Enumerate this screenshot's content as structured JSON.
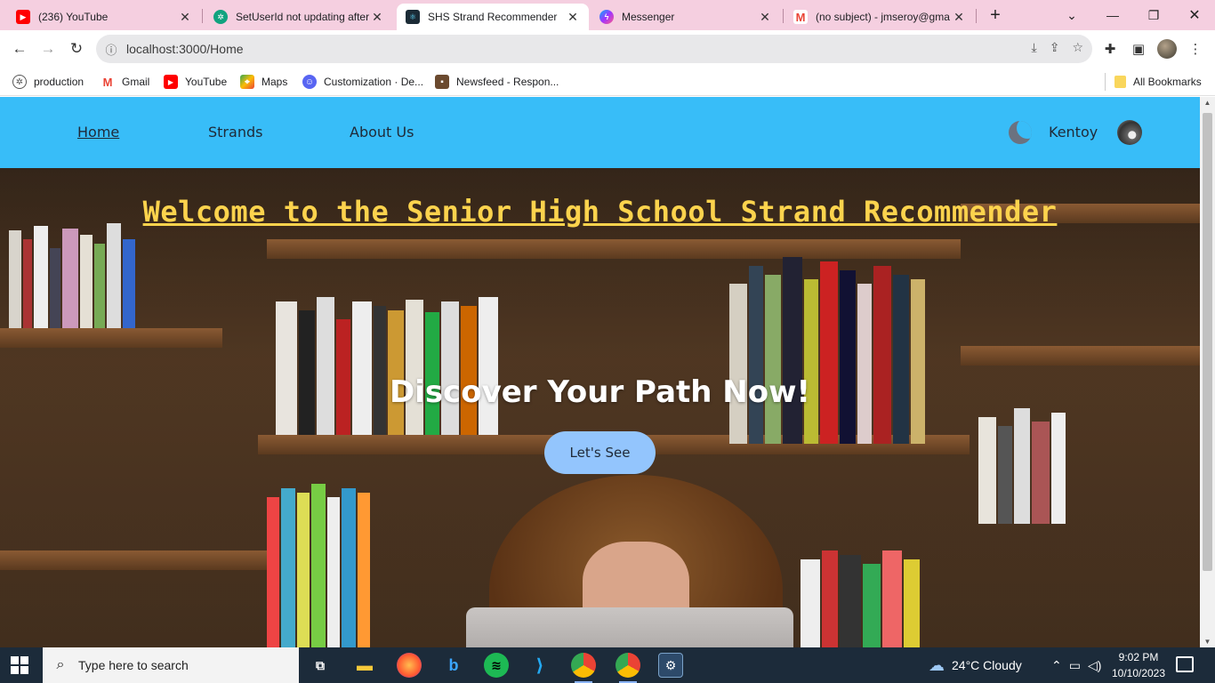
{
  "browser": {
    "tabs": [
      {
        "title": "(236) YouTube",
        "favicon": "youtube-icon",
        "color": "#ff0000"
      },
      {
        "title": "SetUserId not updating after",
        "favicon": "chatgpt-icon",
        "color": "#10a37f"
      },
      {
        "title": "SHS Strand Recommender",
        "favicon": "react-icon",
        "color": "#1b2b36",
        "active": true
      },
      {
        "title": "Messenger",
        "favicon": "messenger-icon",
        "color": "#a033ff"
      },
      {
        "title": "(no subject) - jmseroy@gma",
        "favicon": "gmail-icon",
        "color": "#ea4335"
      }
    ],
    "address": "localhost:3000/Home",
    "bookmarks": [
      {
        "label": "production",
        "icon": "chatgpt-icon"
      },
      {
        "label": "Gmail",
        "icon": "gmail-icon"
      },
      {
        "label": "YouTube",
        "icon": "youtube-icon"
      },
      {
        "label": "Maps",
        "icon": "maps-icon"
      },
      {
        "label": "Customization · De...",
        "icon": "discord-icon"
      },
      {
        "label": "Newsfeed - Respon...",
        "icon": "newsfeed-icon"
      }
    ],
    "all_bookmarks": "All Bookmarks"
  },
  "page": {
    "nav": {
      "home": "Home",
      "strands": "Strands",
      "about": "About Us",
      "username": "Kentoy"
    },
    "hero": {
      "title": "Welcome to the Senior High School Strand Recommender",
      "subtitle": "Discover Your Path Now!",
      "cta": "Let's See"
    },
    "colors": {
      "navbar": "#38bdf8",
      "title": "#fcd34d",
      "cta": "#93c5fd"
    }
  },
  "taskbar": {
    "search_placeholder": "Type here to search",
    "weather": "24°C  Cloudy",
    "time": "9:02 PM",
    "date": "10/10/2023"
  }
}
